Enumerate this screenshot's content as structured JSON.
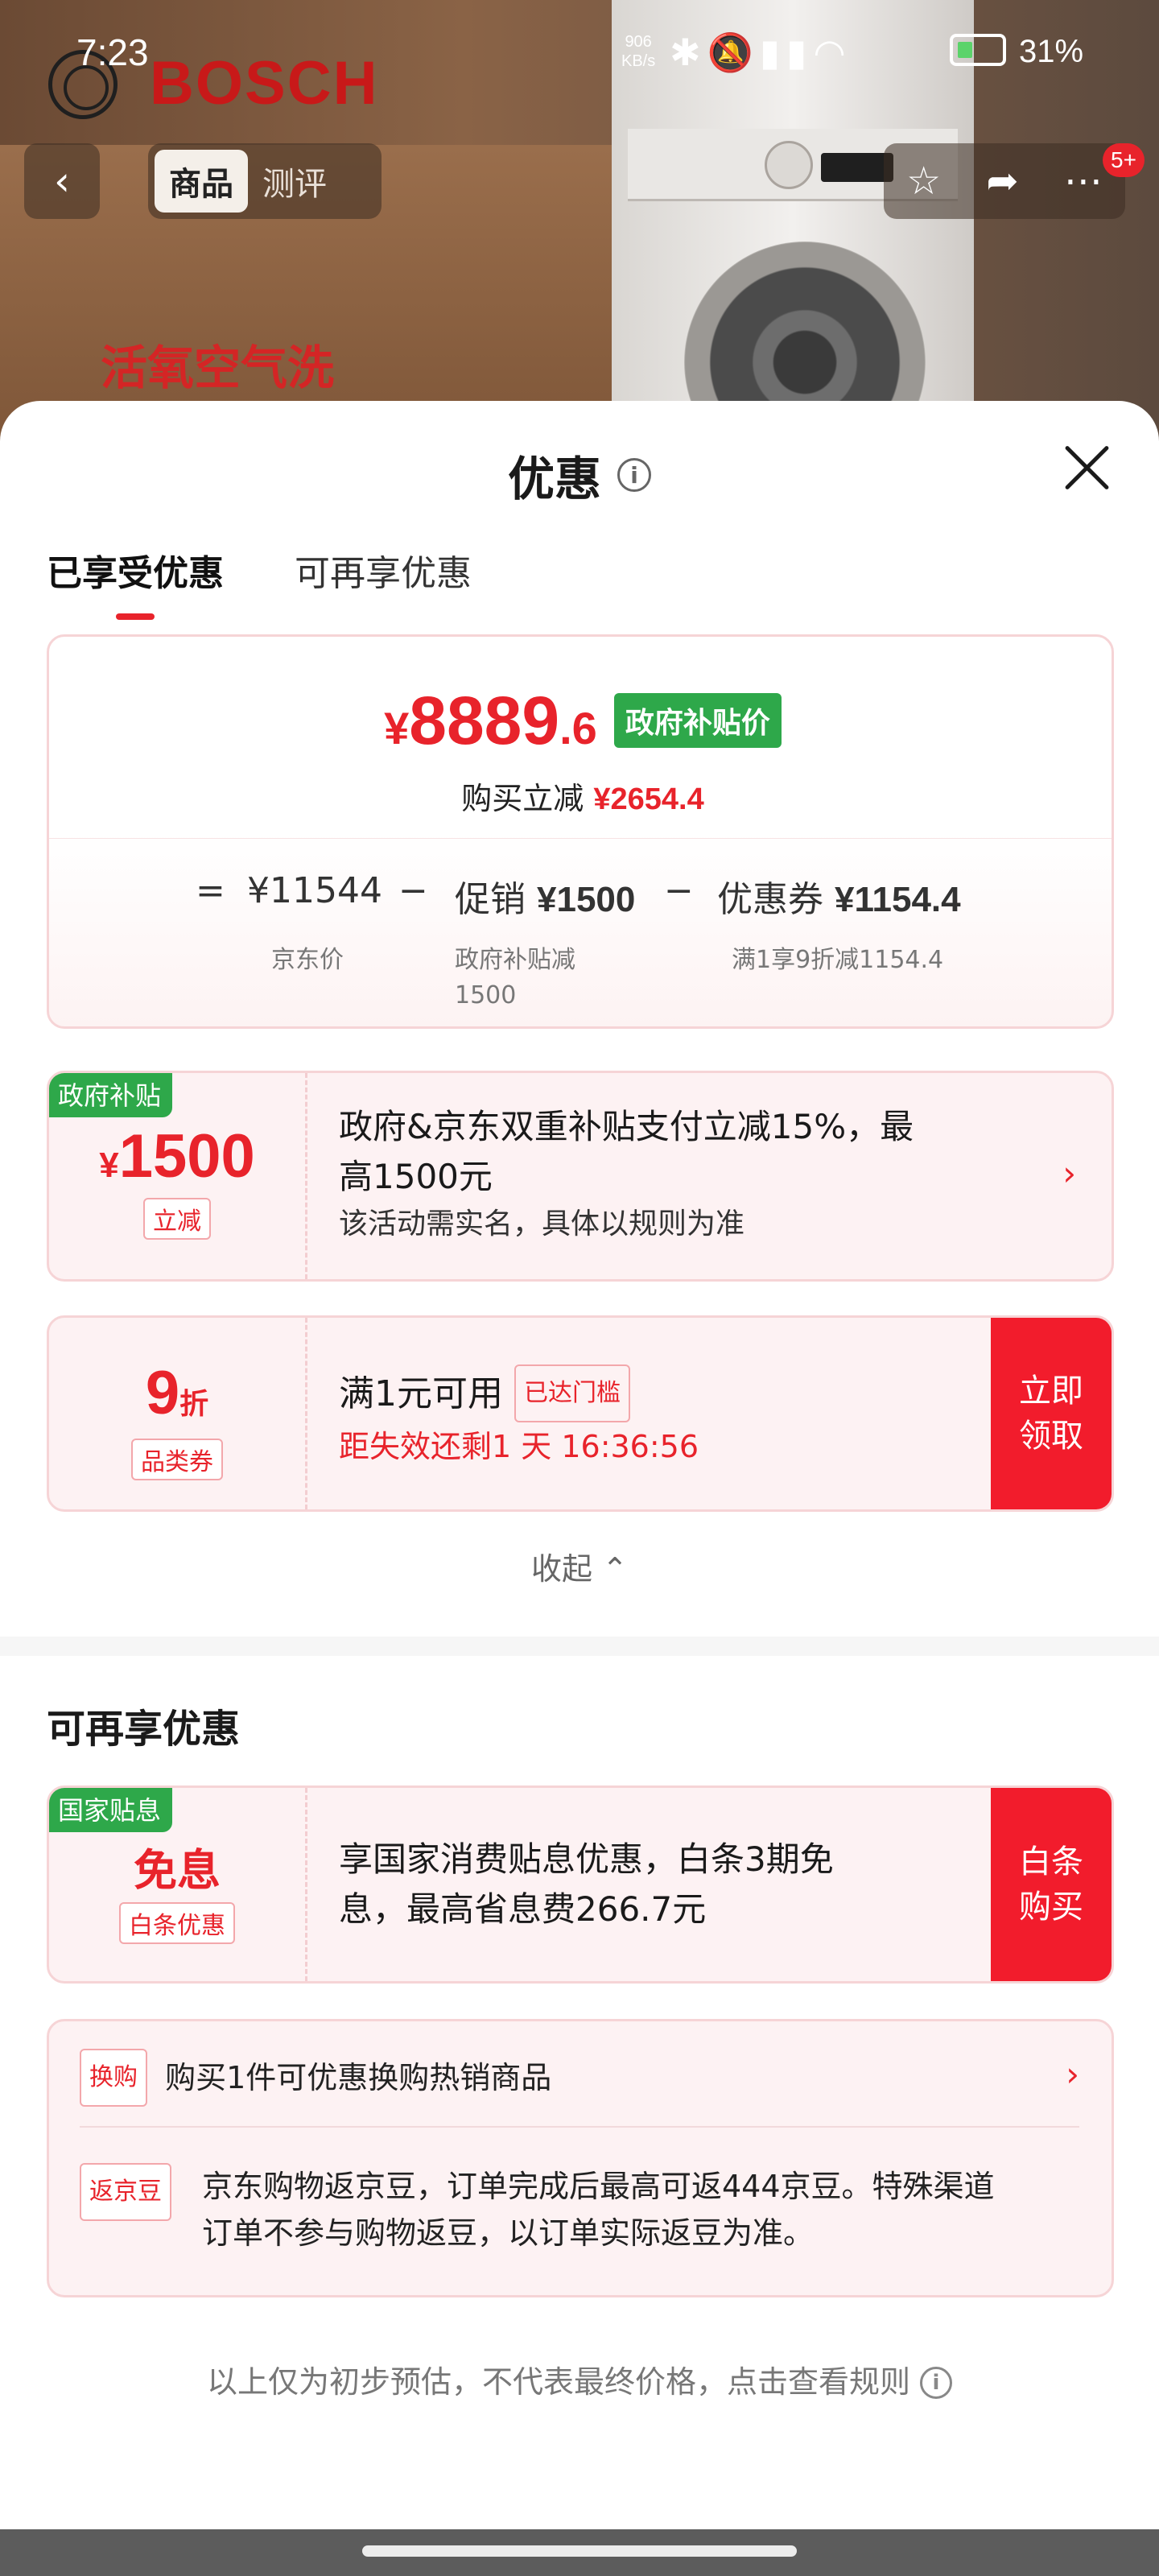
{
  "status_bar": {
    "time": "7:23",
    "net_speed_value": "906",
    "net_speed_unit": "KB/s",
    "icons": [
      "bluetooth-icon",
      "mute-icon",
      "signal-5g-icon",
      "signal-5g-icon",
      "wifi-icon"
    ],
    "battery": "31%"
  },
  "product_header": {
    "brand": "BOSCH",
    "slogan": "活氧空气洗",
    "tabs": [
      "商品",
      "测评"
    ],
    "active_tab": "商品",
    "badge": "5+"
  },
  "sheet": {
    "title": "优惠",
    "tabs": [
      "已享受优惠",
      "可再享优惠"
    ],
    "active_tab": "已享受优惠"
  },
  "price_card": {
    "currency": "¥",
    "price_int": "8889",
    "price_dec": ".6",
    "price_tag": "政府补贴价",
    "save_label": "购买立减",
    "save_amount": "¥2654.4",
    "formula": {
      "eq": "=",
      "base": "¥11544",
      "minus1": "−",
      "promo_label": "促销",
      "promo_amount": "¥1500",
      "minus2": "−",
      "coupon_label": "优惠券",
      "coupon_amount": "¥1154.4",
      "base_sub": "京东价",
      "promo_sub_line1": "政府补贴减",
      "promo_sub_line2": "1500",
      "coupon_sub": "满1享9折减1154.4"
    }
  },
  "gov_subsidy": {
    "tag": "政府补贴",
    "currency": "¥",
    "amount": "1500",
    "type": "立减",
    "line1": "政府&京东双重补贴支付立减15%，最",
    "line2": "高1500元",
    "note": "该活动需实名，具体以规则为准"
  },
  "category_coupon": {
    "discount": "9",
    "unit": "折",
    "type": "品类券",
    "condition": "满1元可用",
    "status": "已达门槛",
    "expiry": "距失效还剩1 天 16:36:56",
    "button_line1": "立即",
    "button_line2": "领取"
  },
  "collapse_label": "收起",
  "more_offers": {
    "title": "可再享优惠",
    "interest_free": {
      "tag": "国家贴息",
      "headline": "免息",
      "type": "白条优惠",
      "line1": "享国家消费贴息优惠，白条3期免",
      "line2": "息，最高省息费266.7元",
      "button_line1": "白条",
      "button_line2": "购买"
    },
    "exchange": {
      "tag": "换购",
      "text": "购买1件可优惠换购热销商品"
    },
    "jingdou": {
      "tag": "返京豆",
      "line1": "京东购物返京豆，订单完成后最高可返444京豆。特殊渠道",
      "line2": "订单不参与购物返豆，以订单实际返豆为准。"
    }
  },
  "footer_note": "以上仅为初步预估，不代表最终价格，点击查看规则",
  "colors": {
    "accent_red": "#e8232b",
    "subsidy_green": "#2ea84a",
    "card_bg": "#fdf2f3"
  }
}
